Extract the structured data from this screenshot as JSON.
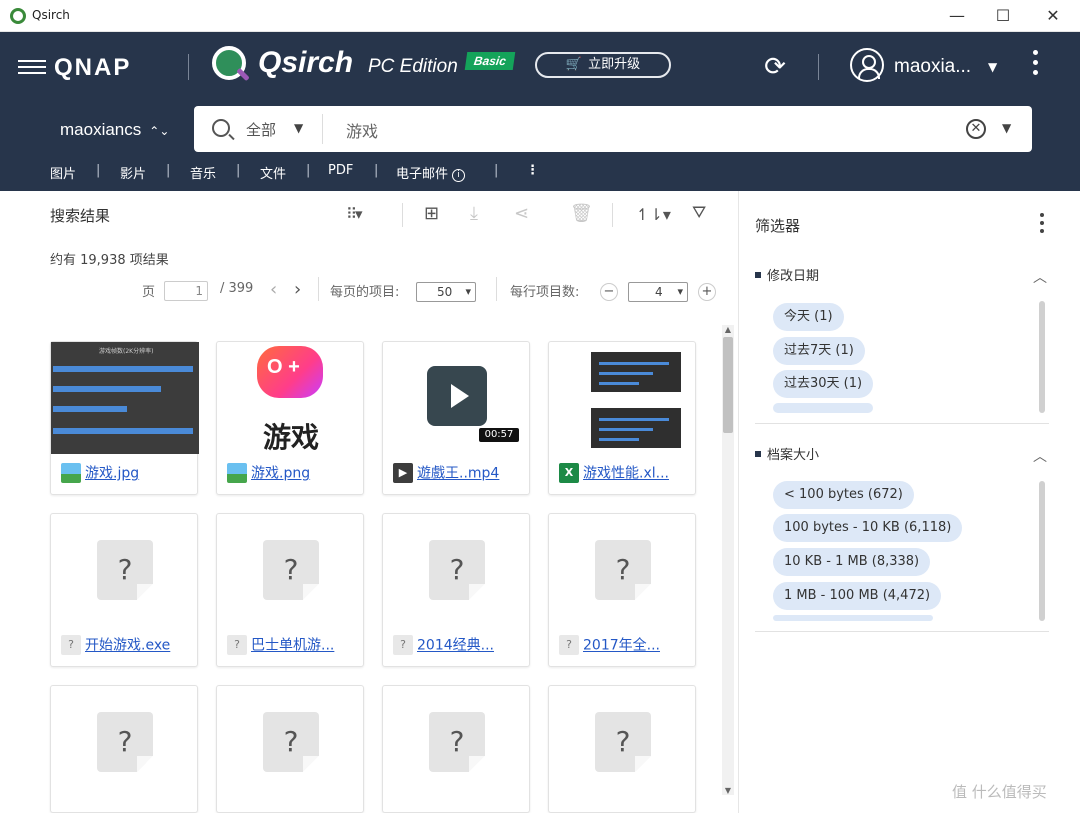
{
  "window": {
    "title": "Qsirch",
    "minimize": "—",
    "maximize": "☐",
    "close": "✕"
  },
  "header": {
    "brand": "QNAP",
    "product_name": "Qsirch",
    "edition": "PC Edition",
    "badge": "Basic",
    "upgrade_label": "立即升级",
    "username": "maoxia..."
  },
  "search": {
    "nas_name": "maoxiancs",
    "scope": "全部",
    "query": "游戏"
  },
  "categories": [
    "图片",
    "影片",
    "音乐",
    "文件",
    "PDF",
    "电子邮件"
  ],
  "toolbar": {
    "results_title": "搜索结果"
  },
  "results": {
    "count_text": "约有 19,938 项结果",
    "page_label": "页",
    "page_value": "1",
    "total_pages": "/ 399",
    "per_page_label": "每页的项目:",
    "per_page_value": "50",
    "per_row_label": "每行项目数:",
    "per_row_value": "4"
  },
  "files": [
    {
      "name": "游戏.jpg",
      "icon": "image-file-icon"
    },
    {
      "name": "游戏.png",
      "icon": "image-file-icon",
      "thumb_text": "游戏"
    },
    {
      "name": "遊戲王..mp4",
      "icon": "video-file-icon",
      "duration": "00:57"
    },
    {
      "name": "游戏性能.xl...",
      "icon": "excel-file-icon"
    },
    {
      "name": "开始游戏.exe",
      "icon": "unknown-file-icon"
    },
    {
      "name": "巴士单机游...",
      "icon": "unknown-file-icon"
    },
    {
      "name": "2014经典...",
      "icon": "unknown-file-icon"
    },
    {
      "name": "2017年全...",
      "icon": "unknown-file-icon"
    }
  ],
  "filters": {
    "title": "筛选器",
    "modified_date": {
      "title": "修改日期",
      "chips": [
        "今天 (1)",
        "过去7天 (1)",
        "过去30天 (1)"
      ]
    },
    "file_size": {
      "title": "档案大小",
      "chips": [
        "< 100 bytes (672)",
        "100 bytes - 10 KB (6,118)",
        "10 KB - 1 MB (8,338)",
        "1 MB - 100 MB (4,472)"
      ]
    }
  },
  "watermark": "值 什么值得买",
  "colors": {
    "header_bg": "#27354b",
    "link": "#2458c6",
    "chip_bg": "#dde8f7",
    "basic_badge": "#14a35a"
  }
}
